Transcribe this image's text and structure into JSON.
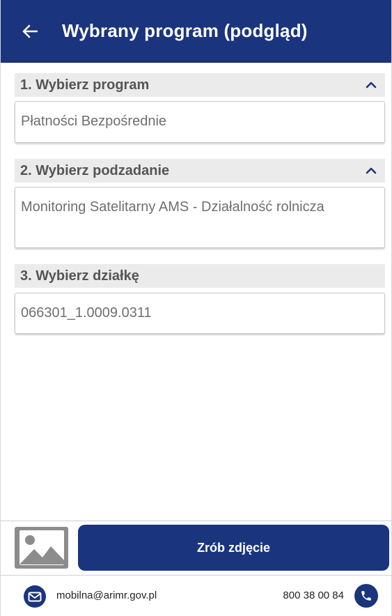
{
  "header": {
    "title": "Wybrany program (podgląd)",
    "back_icon": "arrow-left-icon"
  },
  "sections": [
    {
      "label": "1. Wybierz program",
      "value": "Płatności Bezpośrednie",
      "expanded": true
    },
    {
      "label": "2. Wybierz podzadanie",
      "value": "Monitoring Satelitarny AMS - Działalność rolnicza",
      "expanded": true
    },
    {
      "label": "3. Wybierz działkę",
      "value": "066301_1.0009.0311"
    }
  ],
  "actions": {
    "gallery_icon": "image-icon",
    "photo_label": "Zrób zdjęcie"
  },
  "footer": {
    "email": "mobilna@arimr.gov.pl",
    "phone": "800 38 00 84"
  },
  "colors": {
    "primary": "#1a347e",
    "section_bg": "#ebebeb",
    "gallery_bg": "#8c8c8c"
  }
}
